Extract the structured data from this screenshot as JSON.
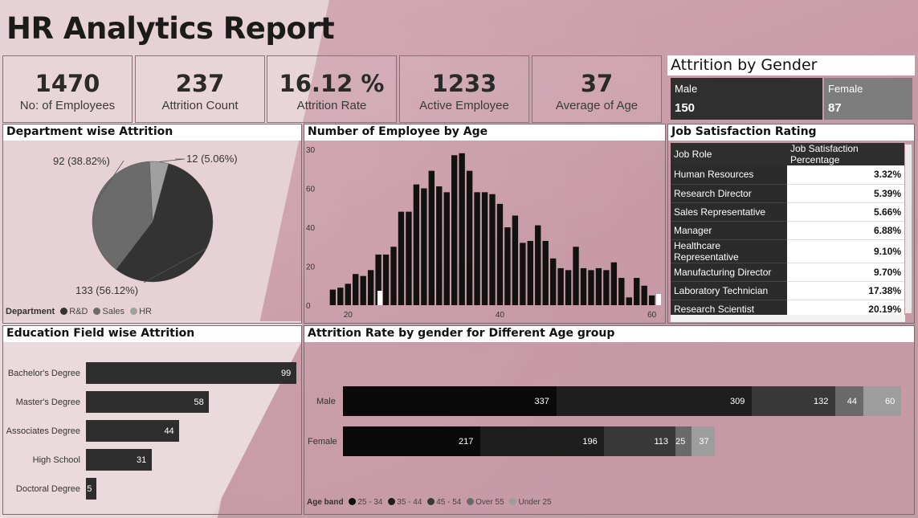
{
  "title": "HR Analytics Report",
  "kpis": [
    {
      "value": "1470",
      "label": "No: of Employees"
    },
    {
      "value": "237",
      "label": "Attrition Count"
    },
    {
      "value": "16.12 %",
      "label": "Attrition Rate"
    },
    {
      "value": "1233",
      "label": "Active Employee"
    },
    {
      "value": "37",
      "label": "Average of Age"
    }
  ],
  "gender": {
    "title": "Attrition by Gender",
    "male_label": "Male",
    "male_value": "150",
    "female_label": "Female",
    "female_value": "87",
    "colors": {
      "male": "#2f2f2f",
      "female": "#7d7d7d"
    }
  },
  "panels": {
    "dept": "Department wise Attrition",
    "age": "Number of Employee by Age",
    "job": "Job Satisfaction Rating",
    "edu": "Education Field wise Attrition",
    "gender_age": "Attrition Rate by gender for Different Age group"
  },
  "dept_legend": {
    "title": "Department",
    "items": [
      "R&D",
      "Sales",
      "HR"
    ]
  },
  "age_legend": {
    "title": "Age band",
    "items": [
      "25 - 34",
      "35 - 44",
      "45 - 54",
      "Over 55",
      "Under 25"
    ]
  },
  "job_table": {
    "headers": [
      "Job Role",
      "Job Satisfaction Percentage"
    ],
    "rows": [
      [
        "Human Resources",
        "3.32%"
      ],
      [
        "Research Director",
        "5.39%"
      ],
      [
        "Sales Representative",
        "5.66%"
      ],
      [
        "Manager",
        "6.88%"
      ],
      [
        "Healthcare Representative",
        "9.10%"
      ],
      [
        "Manufacturing Director",
        "9.70%"
      ],
      [
        "Laboratory Technician",
        "17.38%"
      ],
      [
        "Research Scientist",
        "20.19%"
      ]
    ]
  },
  "chart_data": [
    {
      "type": "pie",
      "title": "Department wise Attrition",
      "categories": [
        "R&D",
        "Sales",
        "HR"
      ],
      "values": [
        133,
        92,
        12
      ],
      "labels": [
        "133 (56.12%)",
        "92 (38.82%)",
        "12 (5.06%)"
      ],
      "colors": [
        "#333333",
        "#6b6b6b",
        "#a0a0a0"
      ],
      "legend": "bottom-left"
    },
    {
      "type": "bar",
      "title": "Number of Employee by Age",
      "x": [
        18,
        19,
        20,
        21,
        22,
        23,
        24,
        25,
        26,
        27,
        28,
        29,
        30,
        31,
        32,
        33,
        34,
        35,
        36,
        37,
        38,
        39,
        40,
        41,
        42,
        43,
        44,
        45,
        46,
        47,
        48,
        49,
        50,
        51,
        52,
        53,
        54,
        55,
        56,
        57,
        58,
        59,
        60
      ],
      "values": [
        8,
        9,
        11,
        16,
        15,
        18,
        26,
        26,
        30,
        48,
        48,
        62,
        60,
        69,
        61,
        58,
        77,
        78,
        69,
        58,
        58,
        57,
        52,
        40,
        46,
        32,
        33,
        41,
        33,
        24,
        19,
        18,
        30,
        19,
        18,
        19,
        18,
        22,
        14,
        4,
        14,
        10,
        5
      ],
      "ylim": [
        0,
        80
      ],
      "yticks": [
        0,
        20,
        40,
        60,
        80
      ],
      "ytick_labels": [
        "0",
        "20",
        "40",
        "60",
        "30"
      ],
      "xticks": [
        20,
        40,
        60
      ],
      "color": "#111111",
      "grid": false
    },
    {
      "type": "bar",
      "orientation": "horizontal",
      "title": "Education Field wise Attrition",
      "categories": [
        "Bachelor's Degree",
        "Master's Degree",
        "Associates Degree",
        "High School",
        "Doctoral Degree"
      ],
      "values": [
        99,
        58,
        44,
        31,
        5
      ],
      "color": "#2d2d2d"
    },
    {
      "type": "bar",
      "orientation": "horizontal",
      "stacked": true,
      "title": "Attrition Rate by gender for Different Age group",
      "categories": [
        "Male",
        "Female"
      ],
      "series": [
        {
          "name": "25 - 34",
          "values": [
            337,
            217
          ],
          "color": "#0a0a0a"
        },
        {
          "name": "35 - 44",
          "values": [
            309,
            196
          ],
          "color": "#1e1e1e"
        },
        {
          "name": "45 - 54",
          "values": [
            132,
            113
          ],
          "color": "#393939"
        },
        {
          "name": "Over 55",
          "values": [
            44,
            25
          ],
          "color": "#6a6a6a"
        },
        {
          "name": "Under 25",
          "values": [
            60,
            37
          ],
          "color": "#9d9d9d"
        }
      ],
      "legend": "bottom-left"
    }
  ]
}
